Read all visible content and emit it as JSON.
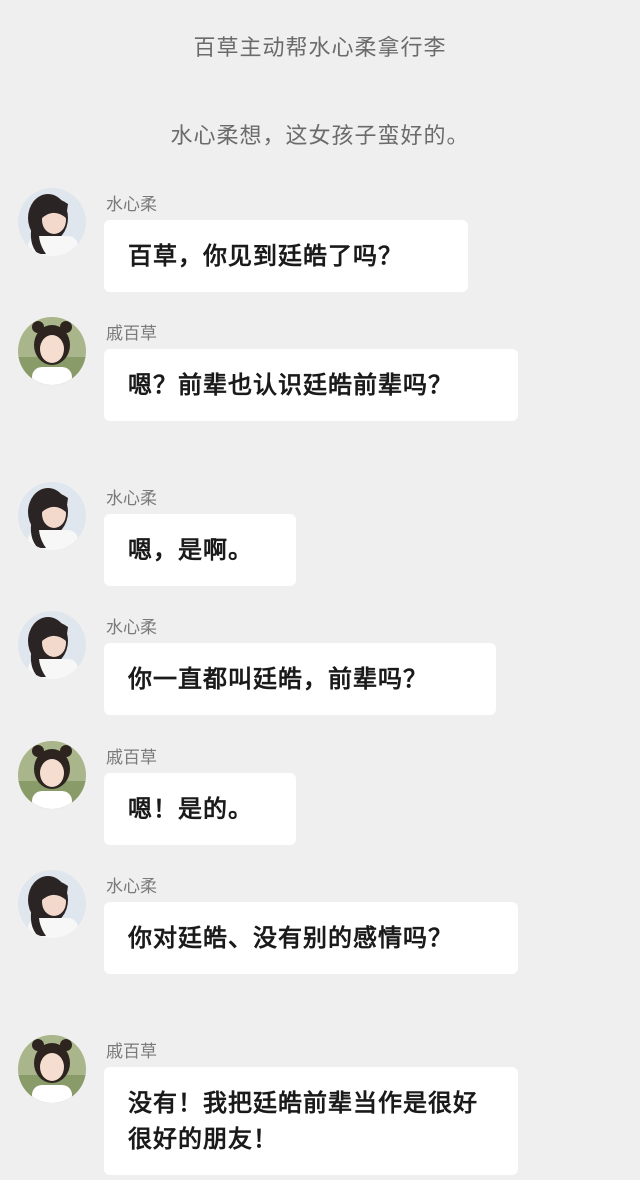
{
  "narration": [
    "百草主动帮水心柔拿行李",
    "水心柔想，这女孩子蛮好的。"
  ],
  "messages": [
    {
      "sender": "水心柔",
      "avatar": "avatar-shui-xinrou-icon",
      "text": "百草，你见到廷皓了吗？"
    },
    {
      "sender": "戚百草",
      "avatar": "avatar-qi-baicao-icon",
      "text": "嗯？前辈也认识廷皓前辈吗？"
    },
    {
      "sender": "水心柔",
      "avatar": "avatar-shui-xinrou-icon",
      "text": "嗯，是啊。"
    },
    {
      "sender": "水心柔",
      "avatar": "avatar-shui-xinrou-icon",
      "text": "你一直都叫廷皓，前辈吗？"
    },
    {
      "sender": "戚百草",
      "avatar": "avatar-qi-baicao-icon",
      "text": "嗯！是的。"
    },
    {
      "sender": "水心柔",
      "avatar": "avatar-shui-xinrou-icon",
      "text": "你对廷皓、没有别的感情吗？"
    },
    {
      "sender": "戚百草",
      "avatar": "avatar-qi-baicao-icon",
      "text": "没有！我把廷皓前辈当作是很好很好的朋友！"
    }
  ],
  "colors": {
    "background": "#efefef",
    "bubble": "#ffffff",
    "sender_text": "#7a7a7a",
    "narration_text": "#6b6b6b"
  }
}
